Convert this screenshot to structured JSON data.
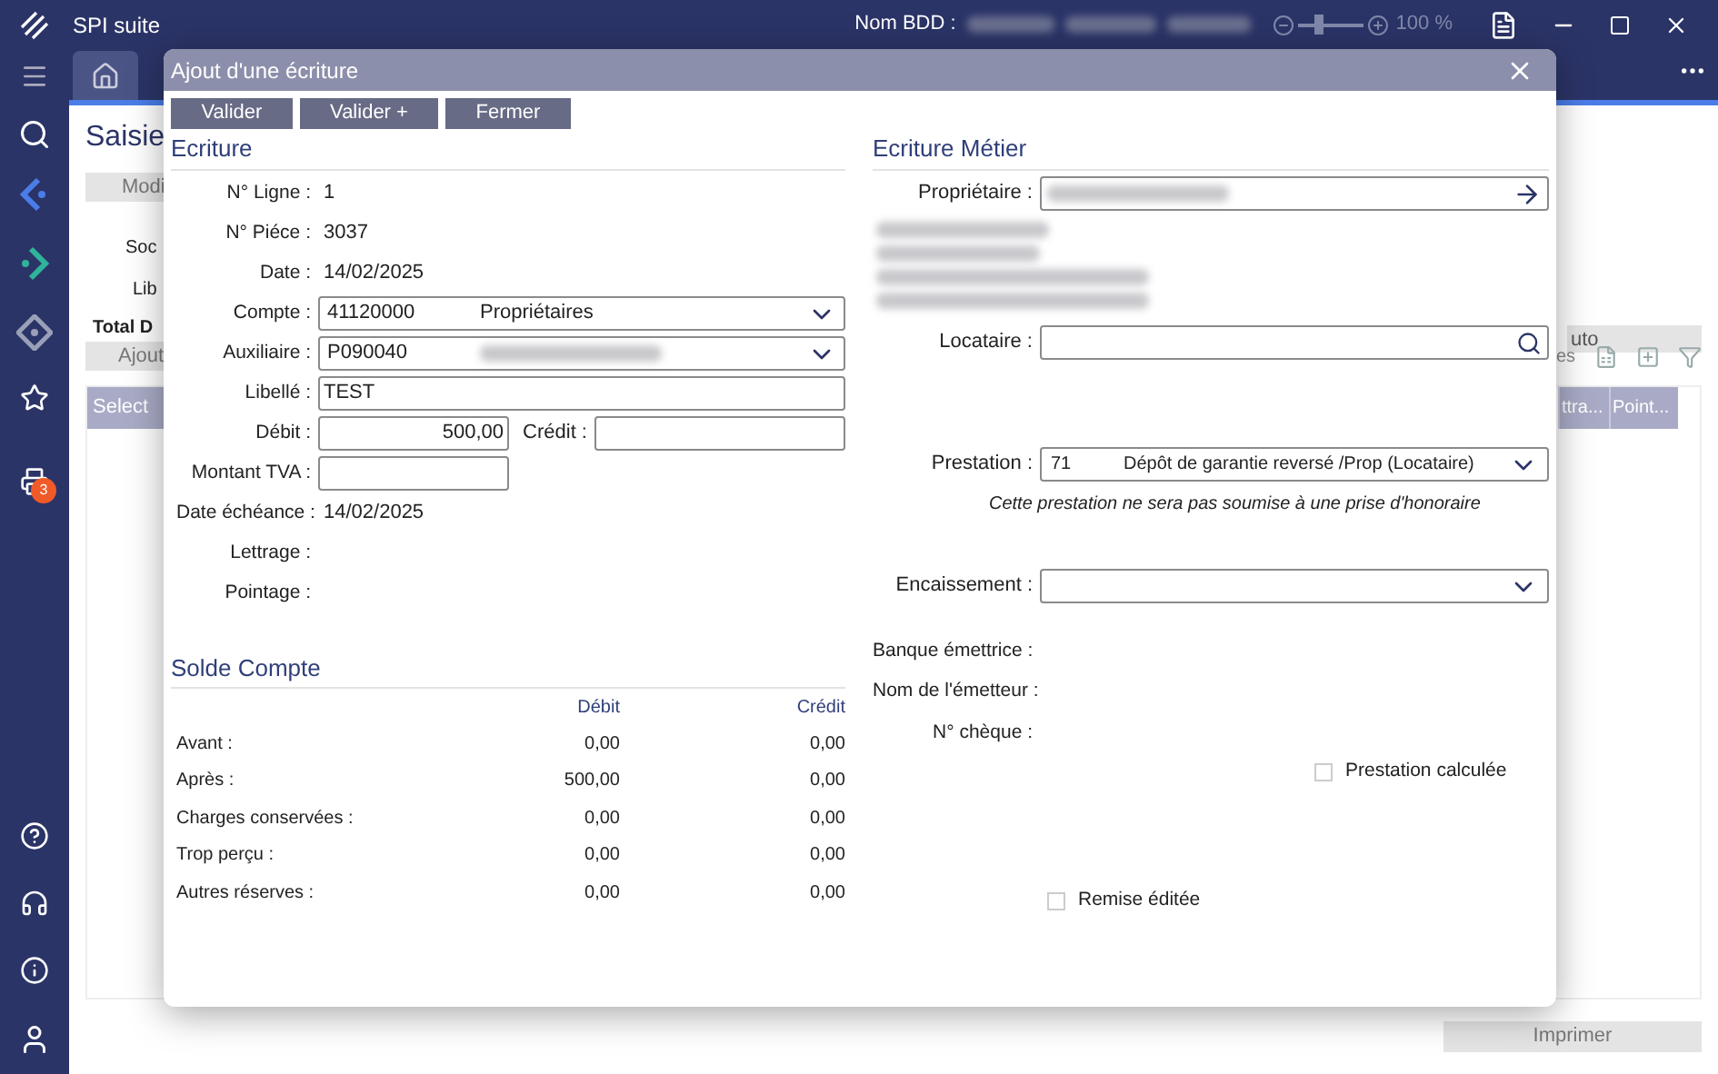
{
  "title_bar": {
    "app_title": "SPI suite",
    "db_label": "Nom BDD :",
    "zoom": {
      "level": 0.3,
      "reading": "100 %"
    }
  },
  "sidebar": {
    "badge": "3"
  },
  "background": {
    "page_title": "Saisie",
    "buttons": [
      "Modi",
      "Ajout"
    ],
    "labels": [
      "Soc",
      "Lib"
    ],
    "total_label": "Total D",
    "right_button": "uto",
    "toolbar_text": "es",
    "columns_left": [
      "Select"
    ],
    "columns_right": [
      "ttra...",
      "Point..."
    ],
    "print_button": "Imprimer"
  },
  "dialog": {
    "title": "Ajout d'une écriture",
    "buttons": [
      "Valider",
      "Valider +",
      "Fermer"
    ],
    "ecriture": {
      "heading": "Ecriture",
      "rows": [
        {
          "kind": "text",
          "label": "N° Ligne :",
          "value": "1"
        },
        {
          "kind": "text",
          "label": "N° Piéce :",
          "value": "3037"
        },
        {
          "kind": "text",
          "label": "Date :",
          "value": "14/02/2025"
        },
        {
          "kind": "select",
          "label": "Compte :",
          "value": "41120000",
          "description": "Propriétaires"
        },
        {
          "kind": "select",
          "label": "Auxiliaire :",
          "value": "P090040",
          "blurred": true
        },
        {
          "kind": "input",
          "label": "Libellé :",
          "value": "TEST"
        },
        {
          "kind": "pair",
          "label": "Débit :",
          "value": "500,00",
          "label_2": "Crédit :"
        },
        {
          "kind": "short_input",
          "label": "Montant TVA :"
        },
        {
          "kind": "text",
          "label": "Date échéance :",
          "value": "14/02/2025"
        },
        {
          "kind": "text",
          "label": "Lettrage :"
        },
        {
          "kind": "text",
          "label": "Pointage :"
        }
      ]
    },
    "solde": {
      "heading": "Solde Compte",
      "columns": [
        "Débit",
        "Crédit"
      ],
      "rows": [
        {
          "label": "Avant :",
          "debit": "0,00",
          "credit": "0,00"
        },
        {
          "label": "Après :",
          "debit": "500,00",
          "credit": "0,00"
        },
        {
          "label": "Charges conservées :",
          "debit": "0,00",
          "credit": "0,00"
        },
        {
          "label": "Trop perçu :",
          "debit": "0,00",
          "credit": "0,00"
        },
        {
          "label": "Autres réserves :",
          "debit": "0,00",
          "credit": "0,00"
        }
      ]
    },
    "metier": {
      "heading": "Ecriture Métier",
      "proprietaire_label": "Propriétaire :",
      "locataire_label": "Locataire :",
      "prestation": {
        "label": "Prestation :",
        "code": "71",
        "description": "Dépôt de garantie reversé /Prop (Locataire)"
      },
      "note": "Cette prestation ne sera pas soumise à une prise d'honoraire",
      "encaissement_label": "Encaissement :",
      "info_labels": [
        "Banque émettrice :",
        "Nom de l'émetteur :",
        "N° chèque :"
      ],
      "checkboxes": [
        {
          "label": "Prestation calculée",
          "checked": false
        },
        {
          "label": "Remise éditée",
          "checked": false
        }
      ]
    }
  }
}
